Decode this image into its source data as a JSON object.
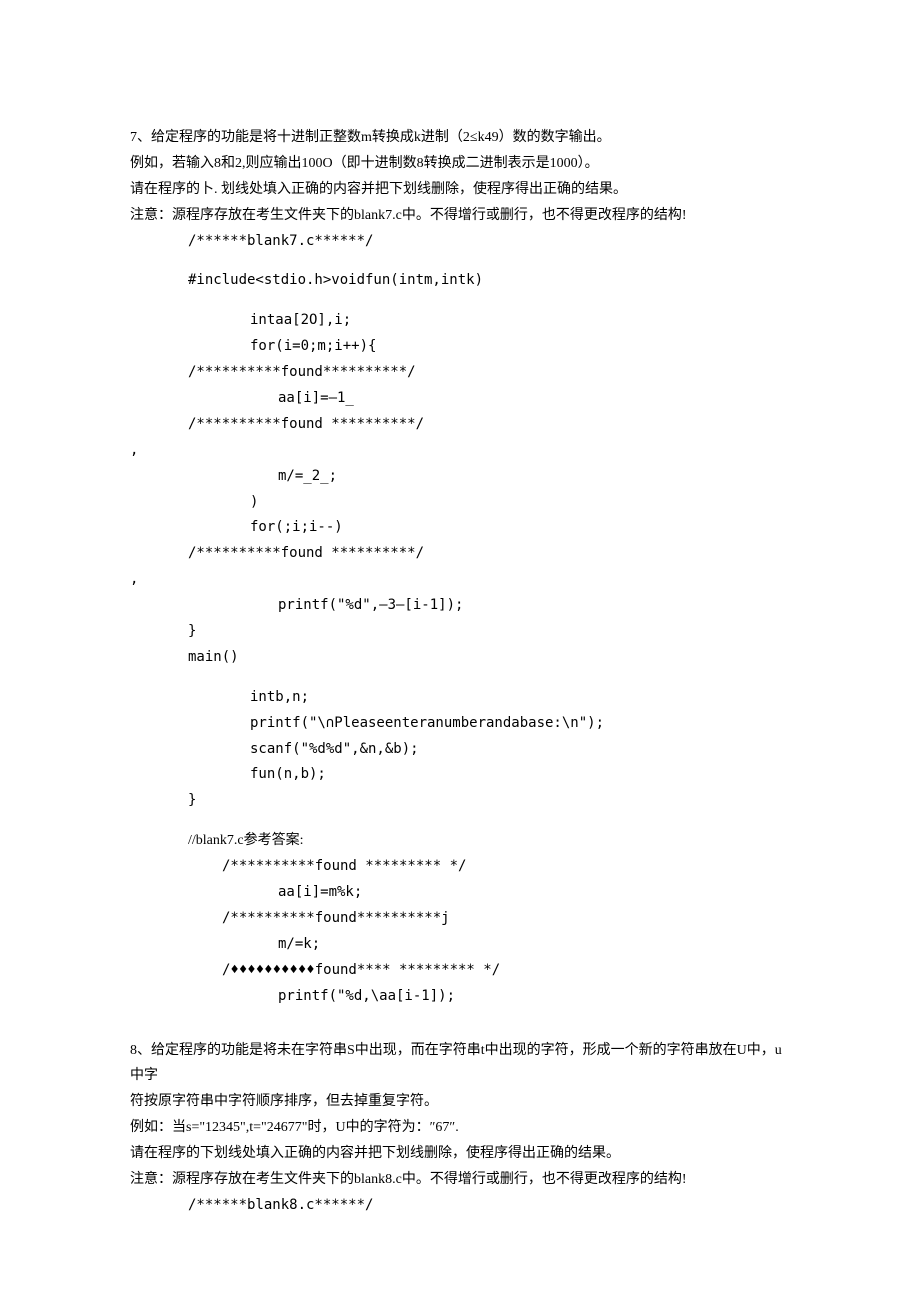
{
  "q7": {
    "p1": "7、给定程序的功能是将十进制正整数m转换成k进制（2≤k49）数的数字输出。",
    "p2": "例如，若输入8和2,则应输出100O（即十进制数8转换成二进制表示是1000）。",
    "p3": "请在程序的卜. 划线处填入正确的内容并把下划线删除，使程序得出正确的结果。",
    "p4": "注意：源程序存放在考生文件夹下的blank7.c中。不得增行或删行，也不得更改程序的结构!",
    "code": {
      "l1": "/******blank7.c******/",
      "l2": "#include<stdio.h>voidfun(intm,intk)",
      "l3": "intaa[2O],i;",
      "l4": "for(i=0;m;i++){",
      "l5": "/**********found**********/",
      "l6": "aa[i]=—1_",
      "l7": "/**********found  **********/",
      "l7a": ",",
      "l8": "m/=_2_;",
      "l9": ")",
      "l10": "for(;i;i--)",
      "l11": "/**********found  **********/",
      "l11a": ",",
      "l12": "printf(\"%d\",—3—[i-1]);",
      "l13": "}",
      "l14": "main()",
      "l15": "intb,n;",
      "l16": "printf(\"\\∩Pleaseenteranumberandabase:\\n\");",
      "l17": "scanf(\"%d%d\",&n,&b);",
      "l18": "fun(n,b);",
      "l19": "}"
    },
    "ans_label": "//blank7.c参考答案:",
    "ans": {
      "a1": "/**********found  *********   */",
      "a2": "aa[i]=m%k;",
      "a3": "/**********found**********j",
      "a4": "m/=k;",
      "a5": "/♦♦♦♦♦♦♦♦♦♦found****  *********   */",
      "a6": "printf(\"%d,\\aa[i-1]);"
    }
  },
  "q8": {
    "p1": "8、给定程序的功能是将未在字符串S中出现，而在字符串t中出现的字符，形成一个新的字符串放在U中，u中字",
    "p1b": "符按原字符串中字符顺序排序，但去掉重复字符。",
    "p2": "例如：当s=\"12345\",t=\"24677\"时，U中的字符为：″67″.",
    "p3": "请在程序的下划线处填入正确的内容并把下划线删除，使程序得出正确的结果。",
    "p4": "注意：源程序存放在考生文件夹下的blank8.c中。不得增行或删行，也不得更改程序的结构!",
    "code": {
      "l1": "/******blank8.c******/"
    }
  }
}
